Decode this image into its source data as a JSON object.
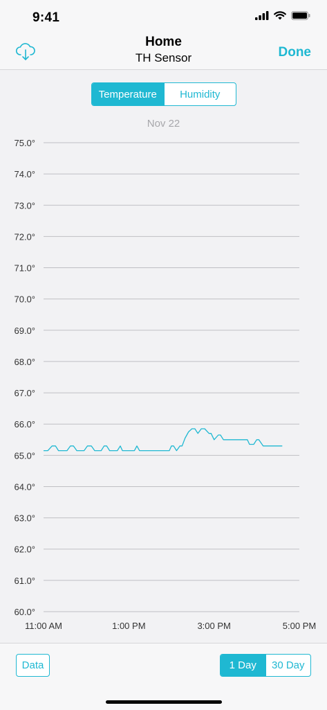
{
  "status_bar": {
    "time": "9:41"
  },
  "nav": {
    "title": "Home",
    "subtitle": "TH Sensor",
    "done_label": "Done",
    "left_icon": "cloud-download-icon"
  },
  "tabs": {
    "items": [
      "Temperature",
      "Humidity"
    ],
    "selected": "Temperature"
  },
  "chart_date": "Nov 22",
  "bottom": {
    "data_label": "Data",
    "ranges": [
      "1 Day",
      "30 Day"
    ],
    "selected_range": "1 Day"
  },
  "colors": {
    "accent": "#1fb8d2",
    "gridline": "#bfbfc3",
    "background": "#f2f2f4"
  },
  "chart_data": {
    "type": "line",
    "title": "",
    "xlabel": "",
    "ylabel": "",
    "ylim": [
      60,
      75
    ],
    "xlim": [
      11.0,
      17.0
    ],
    "y_ticks": [
      "75.0°",
      "74.0°",
      "73.0°",
      "72.0°",
      "71.0°",
      "70.0°",
      "69.0°",
      "68.0°",
      "67.0°",
      "66.0°",
      "65.0°",
      "64.0°",
      "63.0°",
      "62.0°",
      "61.0°",
      "60.0°"
    ],
    "x_ticks": [
      "11:00 AM",
      "1:00 PM",
      "3:00 PM",
      "5:00 PM"
    ],
    "grid": true,
    "series": [
      {
        "color": "#1fb8d2",
        "x": [
          11.0,
          11.1,
          11.2,
          11.28,
          11.35,
          11.55,
          11.63,
          11.7,
          11.78,
          11.95,
          12.03,
          12.12,
          12.2,
          12.35,
          12.42,
          12.48,
          12.55,
          12.73,
          12.8,
          12.85,
          13.13,
          13.19,
          13.25,
          13.95,
          14.0,
          14.05,
          14.12,
          14.2,
          14.25,
          14.32,
          14.4,
          14.48,
          14.55,
          14.62,
          14.7,
          14.78,
          14.88,
          14.93,
          15.0,
          15.1,
          15.15,
          15.22,
          15.35,
          15.48,
          15.78,
          15.83,
          15.93,
          16.0,
          16.05,
          16.15,
          16.35,
          16.6
        ],
        "y": [
          65.15,
          65.15,
          65.3,
          65.3,
          65.15,
          65.15,
          65.3,
          65.3,
          65.15,
          65.15,
          65.3,
          65.3,
          65.15,
          65.15,
          65.3,
          65.3,
          65.15,
          65.15,
          65.3,
          65.15,
          65.15,
          65.3,
          65.15,
          65.15,
          65.3,
          65.3,
          65.15,
          65.3,
          65.3,
          65.55,
          65.75,
          65.85,
          65.85,
          65.7,
          65.85,
          65.85,
          65.7,
          65.7,
          65.5,
          65.65,
          65.65,
          65.5,
          65.5,
          65.5,
          65.5,
          65.35,
          65.35,
          65.5,
          65.5,
          65.3,
          65.3,
          65.3
        ]
      }
    ]
  }
}
